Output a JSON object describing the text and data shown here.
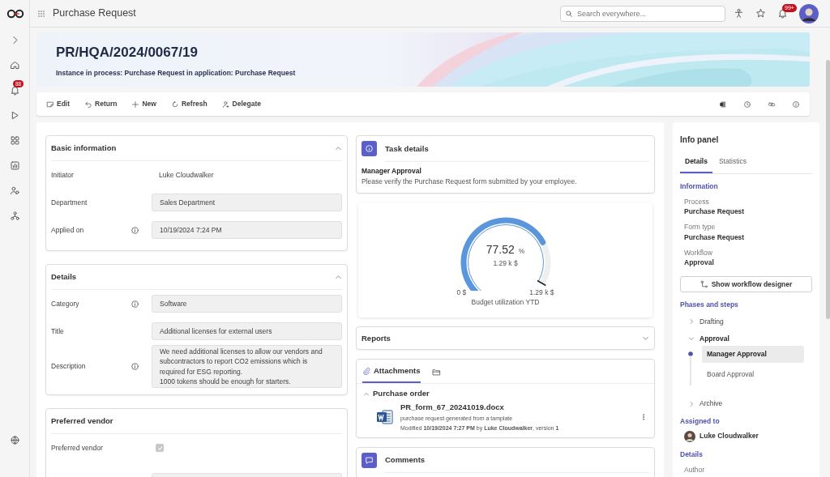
{
  "app": {
    "title": "Purchase Request",
    "search": {
      "placeholder": "Search everywhere..."
    },
    "notifications_badge": "99+"
  },
  "rail": {
    "notifications_badge": "88"
  },
  "header": {
    "title": "PR/HQA/2024/0067/19",
    "subtitle": "Instance in process: Purchase Request in application: Purchase Request"
  },
  "toolbar": {
    "actions": [
      {
        "label": "Edit",
        "kind": "edit"
      },
      {
        "label": "Return",
        "kind": "return"
      },
      {
        "label": "New",
        "kind": "new"
      },
      {
        "label": "Refresh",
        "kind": "refresh"
      },
      {
        "label": "Delegate",
        "kind": "delegate"
      }
    ]
  },
  "sections": [
    {
      "title": "Basic information",
      "expanded": true,
      "fields": [
        {
          "label": "Initiator",
          "value": "Luke Cloudwalker",
          "kind": "text",
          "info": false
        },
        {
          "label": "Department",
          "value": "Sales Department",
          "kind": "input",
          "info": false
        },
        {
          "label": "Applied on",
          "value": "10/19/2024 7:24 PM",
          "kind": "input",
          "info": true
        }
      ]
    },
    {
      "title": "Details",
      "expanded": true,
      "fields": [
        {
          "label": "Category",
          "value": "Software",
          "kind": "input",
          "info": true
        },
        {
          "label": "Title",
          "value": "Additional licenses for external users",
          "kind": "input",
          "info": false
        },
        {
          "label": "Description",
          "value": "We need additional licenses to allow our vendors and subcontractors to report CO2 emissions which is required for ESG reporting.\n1000 tokens should be enough for starters.",
          "kind": "textarea",
          "info": true
        }
      ]
    },
    {
      "title": "Preferred vendor",
      "fields": [
        {
          "label": "Preferred vendor",
          "kind": "checkbox",
          "checked": true,
          "info": false
        }
      ]
    }
  ],
  "task": {
    "title": "Task details",
    "step": "Manager Approval",
    "message": "Please verify the Purchase Request form submitted by your employee."
  },
  "budget_gauge": {
    "value": "77.52",
    "unit": "%",
    "amount": "1.29 k $",
    "min_label": "0 $",
    "max_label": "1.29 k $",
    "caption": "Budget utilization YTD"
  },
  "reports": {
    "title": "Reports",
    "expanded": false
  },
  "attachments": {
    "tabs": [
      {
        "label": "Attachments",
        "kind": "attachments",
        "selected": true
      },
      {
        "kind": "folder",
        "selected": false
      }
    ],
    "group": {
      "title": "Purchase order",
      "expanded": true,
      "files": [
        {
          "name": "PR_form_67_20241019.docx",
          "description": "purchase request generated from a tamplate",
          "modified": "Modified **10/19/2024 7:27 PM** by **Luke Cloudwalker**, version **1**"
        }
      ]
    }
  },
  "comments": {
    "title": "Comments"
  },
  "info_panel": {
    "title": "Info panel",
    "tabs": [
      {
        "label": "Details",
        "selected": true
      },
      {
        "label": "Statistics",
        "selected": false
      }
    ],
    "information": {
      "title": "Information",
      "items": [
        {
          "label": "Process",
          "value": "Purchase Request"
        },
        {
          "label": "Form type",
          "value": "Purchase Request"
        },
        {
          "label": "Workflow",
          "value": "Approval"
        }
      ]
    },
    "workflow_button": "Show workflow designer",
    "phases": {
      "title": "Phases and steps",
      "items": [
        {
          "label": "Drafting",
          "expanded": false
        },
        {
          "label": "Approval",
          "expanded": true,
          "children": [
            {
              "label": "Manager Approval",
              "selected": true
            },
            {
              "label": "Board Approval",
              "selected": false
            }
          ]
        },
        {
          "label": "Archive",
          "expanded": false
        }
      ]
    },
    "assigned": {
      "title": "Assigned to",
      "name": "Luke Cloudwalker"
    },
    "details": {
      "title": "Details",
      "first_label": "Author"
    }
  }
}
